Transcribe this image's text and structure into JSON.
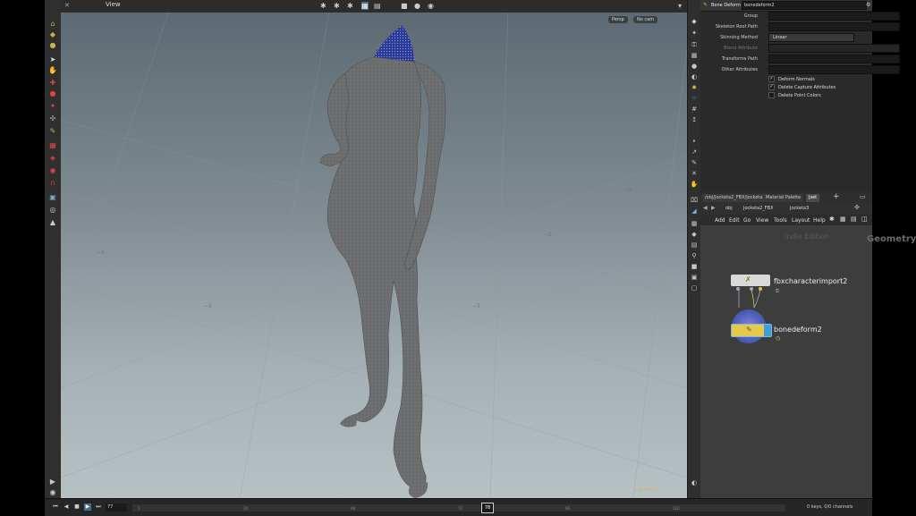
{
  "viewport": {
    "title": "View",
    "camera_mode": "Persp",
    "camera": "No cam",
    "corner_label": "Indie Edition"
  },
  "params": {
    "node_type": "Bone Deform",
    "node_name": "bonedeform2",
    "fields": [
      {
        "label": "Group",
        "value": ""
      },
      {
        "label": "Skeleton Root Path",
        "value": ""
      },
      {
        "label": "Skinning Method",
        "value": "Linear"
      },
      {
        "label": "Blend Attribute",
        "value": ""
      },
      {
        "label": "Transforms Path",
        "value": ""
      },
      {
        "label": "Other Attributes",
        "value": ""
      }
    ],
    "checks": [
      {
        "label": "Deform Normals",
        "checked": true
      },
      {
        "label": "Delete Capture Attributes",
        "checked": true
      },
      {
        "label": "Delete Point Colors",
        "checked": false
      }
    ]
  },
  "network": {
    "tabs": [
      "/obj/Jocketa2_FBX/Jocketa3",
      "Material Palette",
      "Jset"
    ],
    "path": [
      "obj",
      "Jocketa2_FBX",
      "Jocketa3"
    ],
    "menu": [
      "Add",
      "Edit",
      "Go",
      "View",
      "Tools",
      "Layout",
      "Help"
    ],
    "watermark_edition": "Indie Edition",
    "watermark_context": "Geometry",
    "nodes": [
      {
        "name": "fbxcharacterimport2"
      },
      {
        "name": "bonedeform2"
      }
    ]
  },
  "timeline": {
    "current_frame": "77",
    "playhead_label": "78",
    "ticks": [
      "1",
      "24",
      "48",
      "72",
      "96",
      "120"
    ],
    "status": "0 keys, 0/0 channels"
  }
}
